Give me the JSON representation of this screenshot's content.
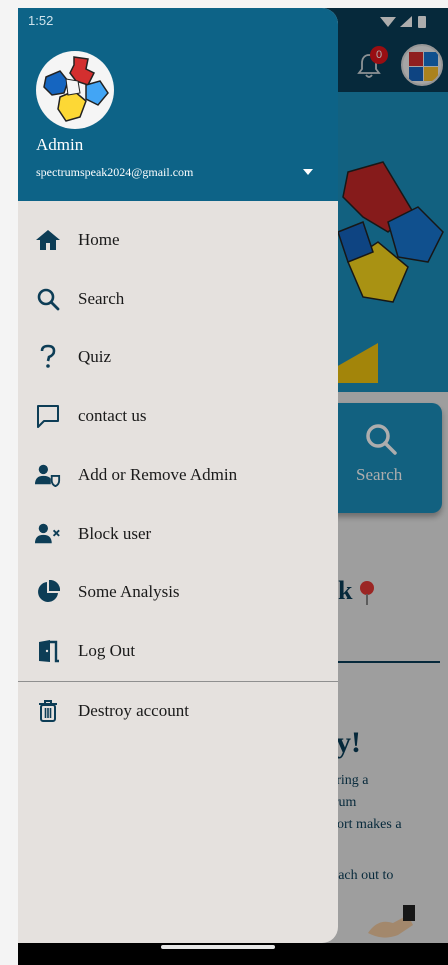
{
  "status_bar": {
    "time": "1:52"
  },
  "drawer": {
    "header": {
      "name": "Admin",
      "email": "spectrumspeak2024@gmail.com",
      "logo_icon": "puzzle-logo-icon"
    },
    "items": [
      {
        "label": "Home",
        "icon": "home-icon"
      },
      {
        "label": "Search",
        "icon": "search-icon"
      },
      {
        "label": "Quiz",
        "icon": "question-icon"
      },
      {
        "label": "contact us",
        "icon": "chat-icon"
      },
      {
        "label": "Add or Remove Admin",
        "icon": "admin-shield-icon"
      },
      {
        "label": "Block user",
        "icon": "block-user-icon"
      },
      {
        "label": "Some Analysis",
        "icon": "pie-chart-icon"
      },
      {
        "label": "Log Out",
        "icon": "logout-door-icon"
      }
    ],
    "footer_item": {
      "label": "Destroy account",
      "icon": "trash-icon"
    }
  },
  "background_app": {
    "notification_count": "0",
    "search_card_label": "Search",
    "heading_fragment": "k",
    "heading2_fragment": "y!",
    "paragraph_lines": [
      "ering a",
      "trum",
      "port makes a"
    ],
    "reach_text": "each out to"
  },
  "colors": {
    "header_blue": "#0d6387",
    "app_dark_blue": "#0a3d57",
    "hero_blue": "#1b8fbd",
    "drawer_bg": "#e5e1de"
  }
}
